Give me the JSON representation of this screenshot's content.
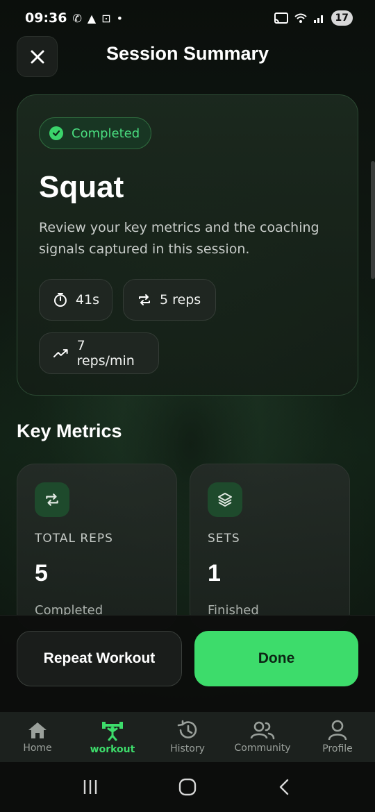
{
  "status_bar": {
    "time": "09:36",
    "battery": "17"
  },
  "header": {
    "title": "Session Summary",
    "close_icon": "close-icon"
  },
  "hero": {
    "badge": "Completed",
    "exercise": "Squat",
    "description": "Review your key metrics and the coaching signals captured in this session.",
    "stats": {
      "duration": "41s",
      "reps": "5 reps",
      "rate": "7 reps/min"
    }
  },
  "key_metrics": {
    "title": "Key Metrics",
    "cards": [
      {
        "icon": "repeat-icon",
        "label": "TOTAL REPS",
        "value": "5",
        "sub": "Completed"
      },
      {
        "icon": "layers-icon",
        "label": "SETS",
        "value": "1",
        "sub": "Finished"
      }
    ]
  },
  "actions": {
    "repeat": "Repeat Workout",
    "done": "Done"
  },
  "nav": {
    "items": [
      {
        "label": "Home",
        "icon": "home-icon"
      },
      {
        "label": "workout",
        "icon": "dumbbell-icon"
      },
      {
        "label": "History",
        "icon": "history-icon"
      },
      {
        "label": "Community",
        "icon": "community-icon"
      },
      {
        "label": "Profile",
        "icon": "profile-icon"
      }
    ],
    "active_index": 1
  },
  "colors": {
    "accent": "#3ddc6b",
    "background": "#0f1711",
    "card_border": "#2c4a33"
  }
}
